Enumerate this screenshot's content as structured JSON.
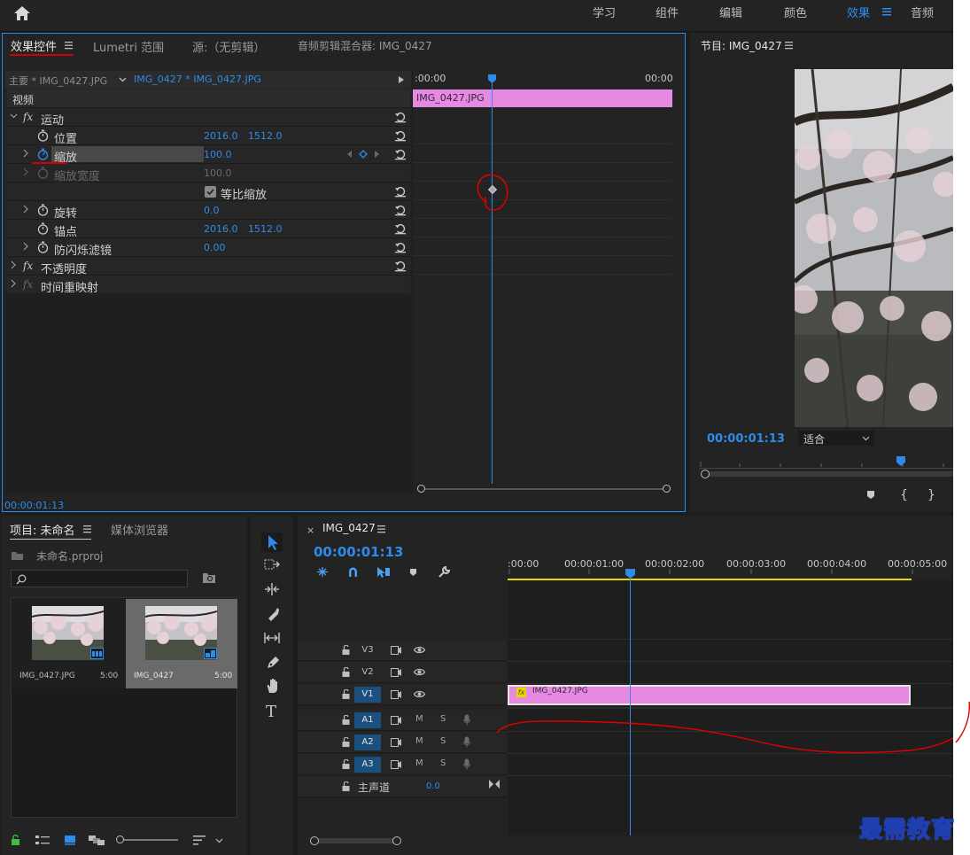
{
  "workspaces": [
    "学习",
    "组件",
    "编辑",
    "颜色",
    "效果",
    "音频"
  ],
  "active_workspace": "效果",
  "effect_controls": {
    "tabs": [
      "效果控件",
      "Lumetri 范围",
      "源:（无剪辑）",
      "音频剪辑混合器: IMG_0427"
    ],
    "master_clip": "主要 * IMG_0427.JPG",
    "sequence_clip": "IMG_0427 * IMG_0427.JPG",
    "time_start": ":00:00",
    "time_end": "00:00",
    "clip_name": "IMG_0427.JPG",
    "section_video": "视频",
    "motion": "运动",
    "params": {
      "position": {
        "label": "位置",
        "x": "2016.0",
        "y": "1512.0"
      },
      "scale": {
        "label": "缩放",
        "value": "100.0"
      },
      "scale_width": {
        "label": "缩放宽度",
        "value": "100.0"
      },
      "uniform_scale": {
        "label": "等比缩放"
      },
      "rotation": {
        "label": "旋转",
        "value": "0.0"
      },
      "anchor": {
        "label": "锚点",
        "x": "2016.0",
        "y": "1512.0"
      },
      "antiflicker": {
        "label": "防闪烁滤镜",
        "value": "0.00"
      }
    },
    "opacity": "不透明度",
    "time_remap": "时间重映射",
    "timecode": "00:00:01:13"
  },
  "program_monitor": {
    "title": "节目: IMG_0427",
    "timecode": "00:00:01:13",
    "fit": "适合"
  },
  "project": {
    "tabs": [
      "项目: 未命名",
      "媒体浏览器"
    ],
    "file": "未命名.prproj",
    "items": [
      {
        "name": "IMG_0427.JPG",
        "duration": "5:00"
      },
      {
        "name": "IMG_0427",
        "duration": "5:00"
      }
    ]
  },
  "timeline": {
    "sequence": "IMG_0427",
    "timecode": "00:00:01:13",
    "ruler": [
      ":00:00",
      "00:00:01:00",
      "00:00:02:00",
      "00:00:03:00",
      "00:00:04:00",
      "00:00:05:00"
    ],
    "tracks_video": [
      "V3",
      "V2",
      "V1"
    ],
    "tracks_audio": [
      "A1",
      "A2",
      "A3"
    ],
    "m": "M",
    "s": "S",
    "master": {
      "label": "主声道",
      "value": "0.0"
    },
    "clip": "IMG_0427.JPG",
    "fx_badge": "fx"
  },
  "watermark": "最需教育"
}
